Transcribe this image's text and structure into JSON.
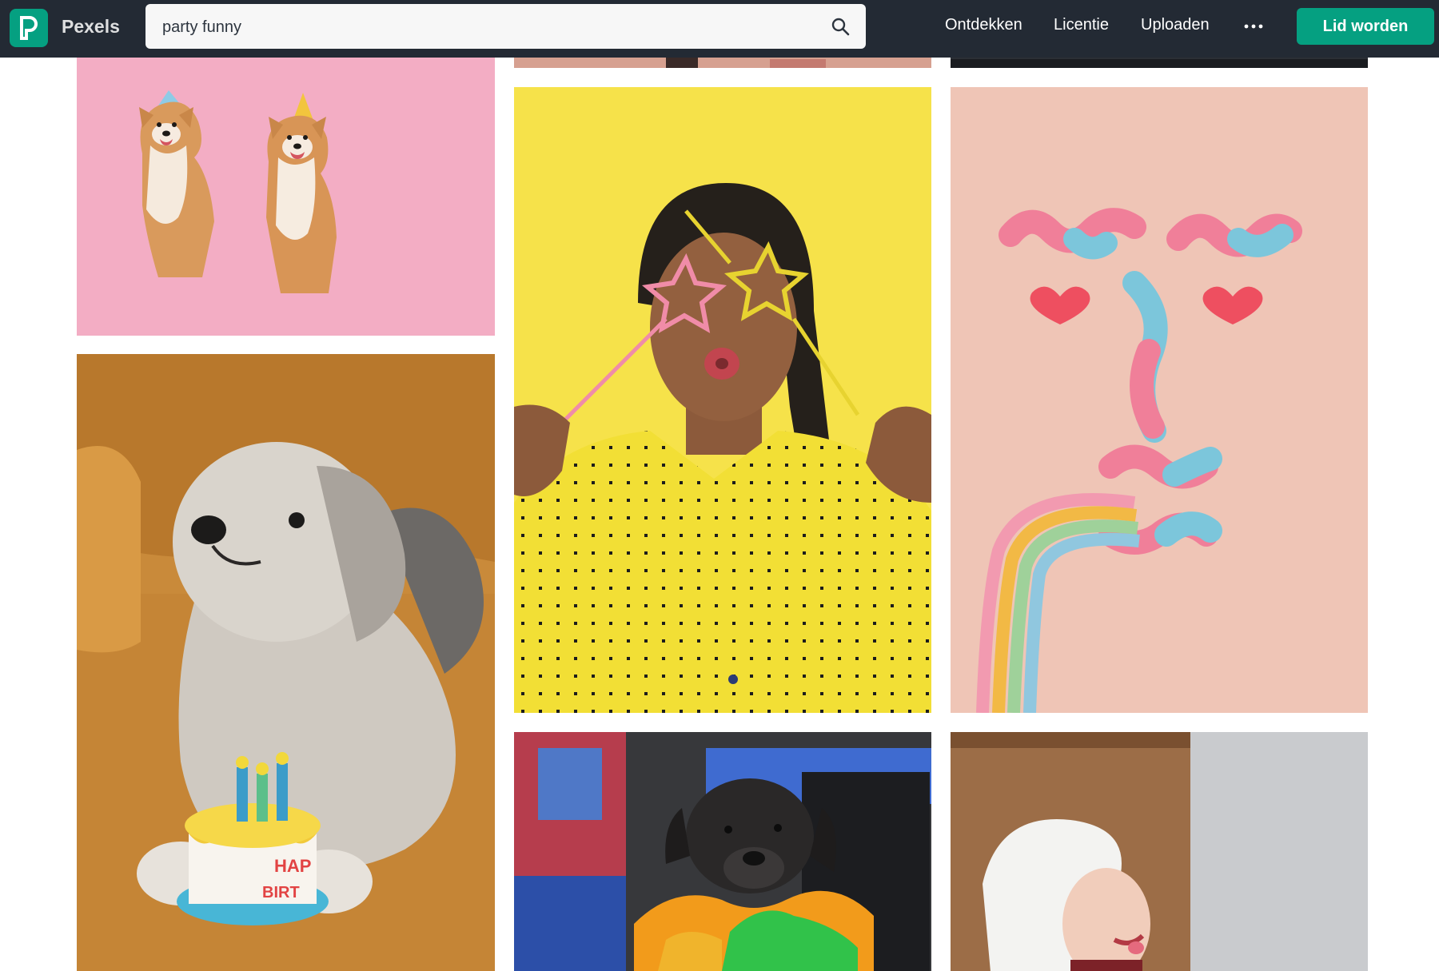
{
  "header": {
    "brand": "Pexels",
    "search_value": "party funny",
    "nav": [
      "Ontdekken",
      "Licentie",
      "Uploaden"
    ],
    "more_label": "•••",
    "join_label": "Lid worden",
    "icons": {
      "logo": "pexels-logo-icon",
      "search": "search-icon",
      "more": "more-icon"
    }
  },
  "photos": [
    {
      "id": "top-mid",
      "alt": "cropped photo (top, middle column)"
    },
    {
      "id": "top-right",
      "alt": "cropped photo (top, right column)"
    },
    {
      "id": "shiba",
      "alt": "Two shiba inu dogs wearing party hats on pink background"
    },
    {
      "id": "yellow",
      "alt": "Woman in yellow polka-dot shirt with star-shaped straw glasses"
    },
    {
      "id": "candy",
      "alt": "Face made of sour gummy worms on pink background"
    },
    {
      "id": "terrier",
      "alt": "Terrier dog lying on orange couch with birthday cake toy"
    },
    {
      "id": "pug",
      "alt": "Black dog wearing colorful feather boa"
    },
    {
      "id": "towel",
      "alt": "Woman with towel on head laughing"
    }
  ],
  "cake_text": [
    "HAP",
    "BIRT"
  ],
  "colors": {
    "header_bg": "#232a34",
    "accent": "#05a081"
  }
}
